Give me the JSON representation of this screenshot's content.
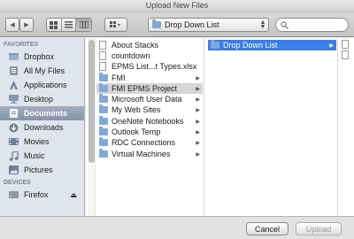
{
  "window": {
    "title": "Upload New Files"
  },
  "toolbar": {
    "back_glyph": "◀",
    "forward_glyph": "▶",
    "path_label": "Drop Down List",
    "chevron_glyph": "⌃⌄"
  },
  "sidebar": {
    "favorites_heading": "FAVORITES",
    "devices_heading": "DEVICES",
    "favorites": [
      {
        "label": "Dropbox",
        "icon": "dropbox-icon"
      },
      {
        "label": "All My Files",
        "icon": "all-files-icon"
      },
      {
        "label": "Applications",
        "icon": "applications-icon"
      },
      {
        "label": "Desktop",
        "icon": "desktop-icon"
      },
      {
        "label": "Documents",
        "icon": "documents-icon"
      },
      {
        "label": "Downloads",
        "icon": "downloads-icon"
      },
      {
        "label": "Movies",
        "icon": "movies-icon"
      },
      {
        "label": "Music",
        "icon": "music-icon"
      },
      {
        "label": "Pictures",
        "icon": "pictures-icon"
      }
    ],
    "selected_favorite": "Documents",
    "devices": [
      {
        "label": "Firefox",
        "icon": "drive-icon",
        "eject": "⏏"
      }
    ]
  },
  "browser": {
    "column1": [
      {
        "label": "About Stacks",
        "kind": "file"
      },
      {
        "label": "countdown",
        "kind": "file"
      },
      {
        "label": "EPMS List...t Types.xlsx",
        "kind": "file"
      },
      {
        "label": "FMI",
        "kind": "folder"
      },
      {
        "label": "FMI EPMS Project",
        "kind": "folder",
        "selected": true
      },
      {
        "label": "Microsoft User Data",
        "kind": "folder"
      },
      {
        "label": "My Web Sites",
        "kind": "folder"
      },
      {
        "label": "OneNote Notebooks",
        "kind": "folder"
      },
      {
        "label": "Outlook Temp",
        "kind": "folder"
      },
      {
        "label": "RDC Connections",
        "kind": "folder"
      },
      {
        "label": "Virtual Machines",
        "kind": "folder"
      }
    ],
    "column2": [
      {
        "label": "Drop Down List",
        "kind": "folder",
        "selected": true
      }
    ],
    "arrow_glyph": "▶"
  },
  "footer": {
    "cancel_label": "Cancel",
    "upload_label": "Upload",
    "upload_enabled": false
  },
  "colors": {
    "selection_blue": "#3a7ee8",
    "sidebar_bg": "#dfe5ec",
    "folder_blue": "#7fa9d8"
  }
}
